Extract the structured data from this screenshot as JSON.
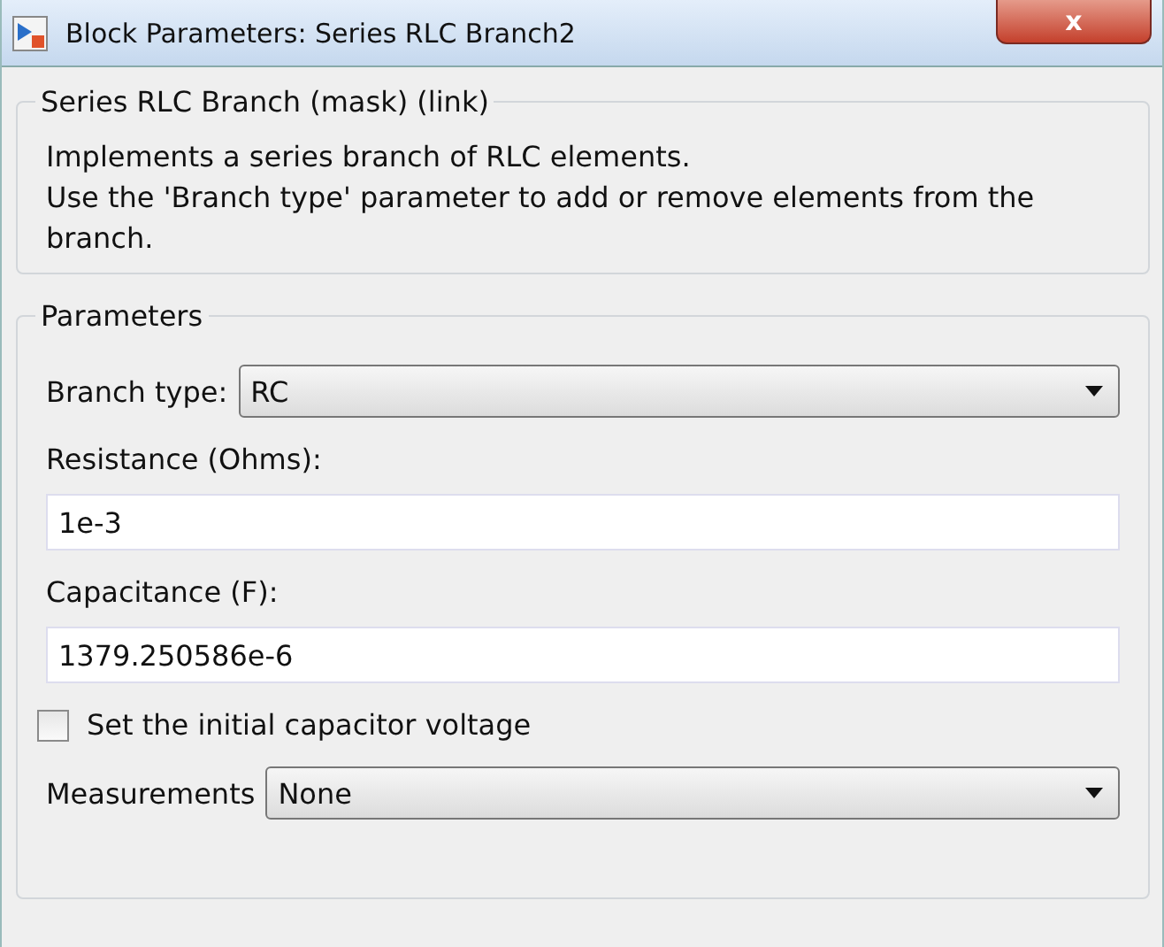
{
  "window": {
    "title": "Block Parameters: Series RLC Branch2",
    "close": "x"
  },
  "description": {
    "title": "Series RLC Branch (mask) (link)",
    "lines": [
      "Implements a series branch of RLC elements.",
      "Use the 'Branch type' parameter to add or remove elements from the branch."
    ]
  },
  "parameters": {
    "title": "Parameters",
    "items": [
      {
        "kind": "dropdown",
        "label": "Branch type:",
        "value": "RC"
      },
      {
        "kind": "text",
        "label": "Resistance (Ohms):",
        "value": "1e-3"
      },
      {
        "kind": "text",
        "label": "Capacitance (F):",
        "value": "1379.250586e-6"
      },
      {
        "kind": "checkbox",
        "label": "Set the initial capacitor voltage",
        "checked": false
      },
      {
        "kind": "dropdown",
        "label": "Measurements",
        "value": "None"
      }
    ]
  }
}
